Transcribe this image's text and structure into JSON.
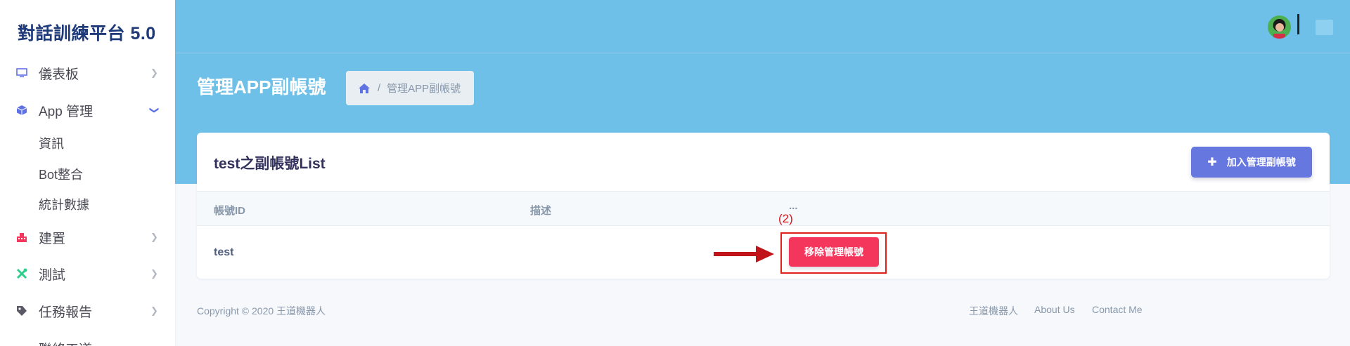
{
  "sidebar": {
    "brand": "對話訓練平台 5.0",
    "items": [
      {
        "label": "儀表板",
        "icon": "monitor-icon"
      },
      {
        "label": "App 管理",
        "icon": "cube-icon",
        "expanded": true
      },
      {
        "label": "建置",
        "icon": "building-icon"
      },
      {
        "label": "測試",
        "icon": "tools-icon"
      },
      {
        "label": "任務報告",
        "icon": "tag-icon"
      },
      {
        "label": "聯絡工道",
        "icon": "contact-icon"
      }
    ],
    "sub_items": [
      "資訊",
      "Bot整合",
      "統計數據"
    ]
  },
  "header": {
    "page_title": "管理APP副帳號",
    "breadcrumb": {
      "current": "管理APP副帳號",
      "separator": "/"
    }
  },
  "card": {
    "title": "test之副帳號List",
    "add_button": "加入管理副帳號",
    "columns": [
      "帳號ID",
      "描述",
      "..."
    ],
    "rows": [
      {
        "id": "test",
        "description": "",
        "action": "移除管理帳號"
      }
    ]
  },
  "annotation": {
    "label": "(2)",
    "color": "#e0201b"
  },
  "footer": {
    "copyright": "Copyright © 2020 王道機器人",
    "links": [
      "王道機器人",
      "About Us",
      "Contact Me"
    ]
  },
  "colors": {
    "primary": "#6777e0",
    "danger": "#f5365c",
    "hero": "#6ec0e8",
    "brand_text": "#1f3a7a"
  }
}
